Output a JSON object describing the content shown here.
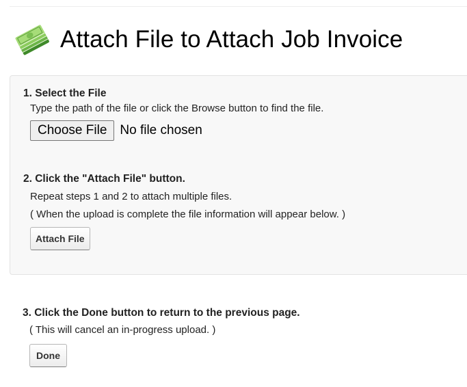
{
  "header": {
    "title": "Attach File to Attach Job Invoice",
    "icon": "money-stack-icon"
  },
  "step1": {
    "heading": "1. Select the File",
    "instruction": "Type the path of the file or click the Browse button to find the file.",
    "choose_file_label": "Choose File",
    "file_status": "No file chosen"
  },
  "step2": {
    "heading": "2. Click the \"Attach File\" button.",
    "instruction": "Repeat steps 1 and 2 to attach multiple files.",
    "note": "( When the upload is complete the file information will appear below. )",
    "attach_label": "Attach File"
  },
  "step3": {
    "heading": "3. Click the Done button to return to the previous page.",
    "note": "( This will cancel an in-progress upload. )",
    "done_label": "Done"
  },
  "colors": {
    "panel_background": "#f8f8f8",
    "panel_border": "#e3e3e3",
    "icon_green": "#5aa63a"
  }
}
